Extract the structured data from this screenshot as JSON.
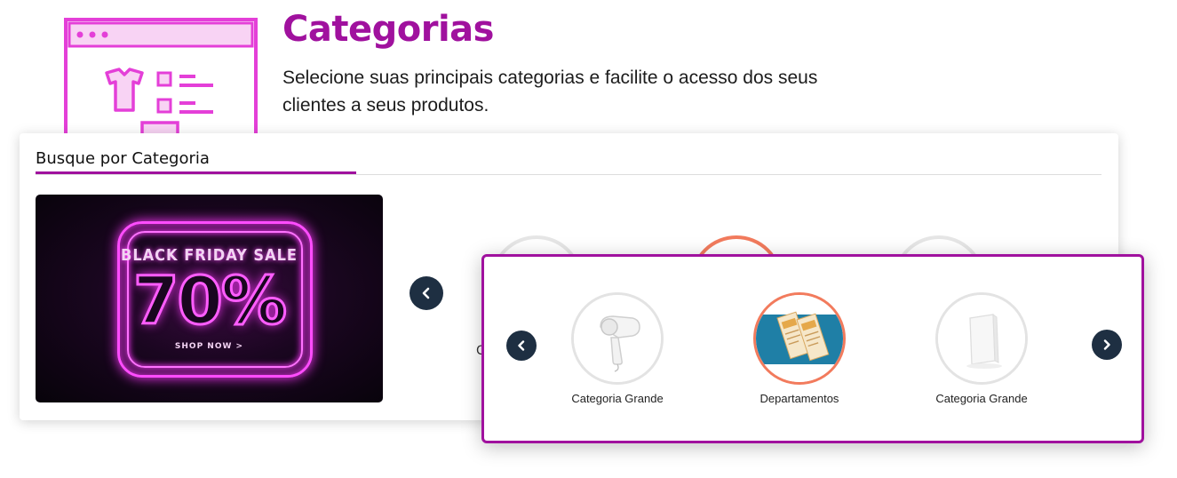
{
  "hero": {
    "title": "Categorias",
    "description": "Selecione suas principais categorias e facilite o acesso dos seus clientes a seus produtos."
  },
  "section": {
    "heading": "Busque por Categoria"
  },
  "banner": {
    "headline": "BLACK FRIDAY SALE",
    "percent": "70%",
    "cta": "SHOP NOW >"
  },
  "background_carousel": {
    "label_fragment": "C"
  },
  "carousel": {
    "items": [
      {
        "label": "Categoria Grande",
        "icon": "hair-dryer-icon",
        "active": false
      },
      {
        "label": "Departamentos",
        "icon": "brochure-icon",
        "active": true
      },
      {
        "label": "Categoria Grande",
        "icon": "white-box-icon",
        "active": false
      }
    ]
  },
  "colors": {
    "brand": "#a0119e",
    "illustration": "#e43fd8",
    "nav_button": "#1e2f42",
    "active_ring": "#f27b5d",
    "inactive_ring": "#e3e3e3"
  }
}
